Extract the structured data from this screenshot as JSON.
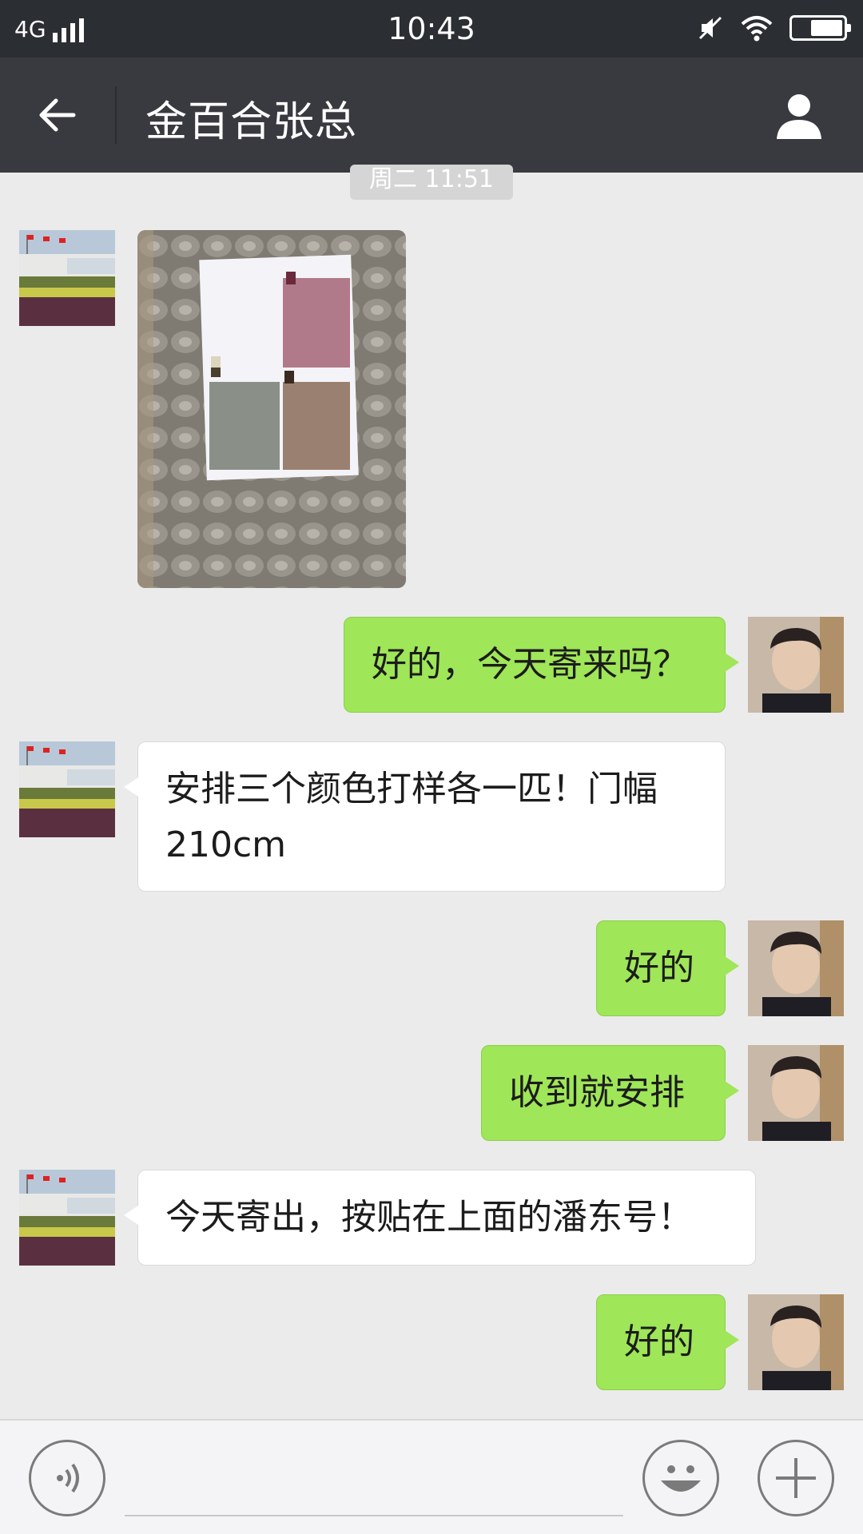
{
  "status_bar": {
    "network": "4G",
    "time": "10:43"
  },
  "header": {
    "title": "金百合张总"
  },
  "chat": {
    "timestamp": "周二 11:51",
    "messages": [
      {
        "side": "left",
        "type": "image",
        "alt": ""
      },
      {
        "side": "right",
        "type": "text",
        "text": "好的，今天寄来吗？"
      },
      {
        "side": "left",
        "type": "text",
        "line1": "安排三个颜色打样各一匹！门幅",
        "line2": "210cm"
      },
      {
        "side": "right",
        "type": "text",
        "text": "好的"
      },
      {
        "side": "right",
        "type": "text",
        "text": "收到就安排"
      },
      {
        "side": "left",
        "type": "text",
        "text": "今天寄出，按贴在上面的潘东号！"
      },
      {
        "side": "right",
        "type": "text",
        "text": "好的"
      }
    ]
  },
  "colors": {
    "nav_bg": "#393a3f",
    "status_bg": "#2b2e32",
    "chat_bg": "#ebebeb",
    "bubble_right": "#9fe658",
    "bubble_left": "#ffffff"
  },
  "icons": {
    "back": "back-arrow-icon",
    "profile": "person-icon",
    "voice": "voice-icon",
    "emoji": "emoji-icon",
    "plus": "plus-icon"
  }
}
